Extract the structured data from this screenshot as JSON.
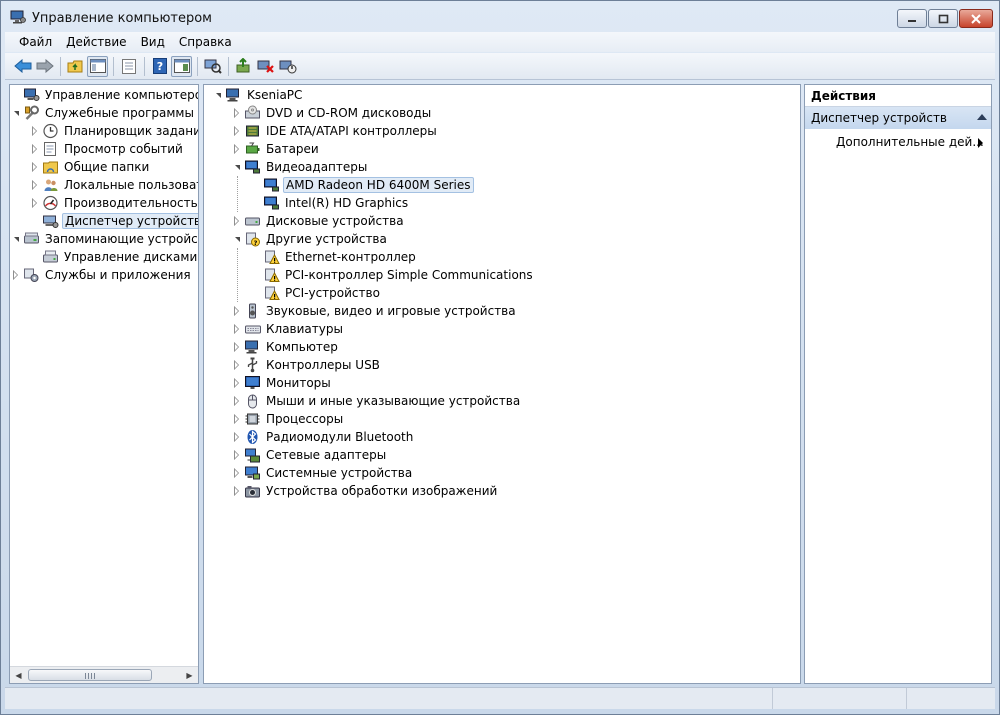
{
  "window": {
    "title": "Управление компьютером"
  },
  "menu": [
    "Файл",
    "Действие",
    "Вид",
    "Справка"
  ],
  "left_tree": [
    {
      "label": "Управление компьютером (л",
      "icon": "computer-management-icon",
      "expander": "none"
    },
    {
      "label": "Служебные программы",
      "icon": "tools-icon",
      "expander": "expanded"
    },
    {
      "label": "Планировщик заданий",
      "icon": "clock-icon",
      "expander": "collapsed"
    },
    {
      "label": "Просмотр событий",
      "icon": "event-viewer-icon",
      "expander": "collapsed"
    },
    {
      "label": "Общие папки",
      "icon": "shared-folder-icon",
      "expander": "collapsed"
    },
    {
      "label": "Локальные пользовате",
      "icon": "users-icon",
      "expander": "collapsed"
    },
    {
      "label": "Производительность",
      "icon": "performance-icon",
      "expander": "collapsed"
    },
    {
      "label": "Диспетчер устройств",
      "icon": "device-manager-icon",
      "expander": "none",
      "selected": true
    },
    {
      "label": "Запоминающие устройст",
      "icon": "storage-icon",
      "expander": "expanded"
    },
    {
      "label": "Управление дисками",
      "icon": "disk-management-icon",
      "expander": "none"
    },
    {
      "label": "Службы и приложения",
      "icon": "services-icon",
      "expander": "collapsed"
    }
  ],
  "device_tree": [
    {
      "label": "KseniaPC",
      "icon": "computer-icon",
      "expander": "expanded"
    },
    {
      "label": "DVD и CD-ROM дисководы",
      "icon": "dvd-drive-icon",
      "expander": "collapsed"
    },
    {
      "label": "IDE ATA/ATAPI контроллеры",
      "icon": "ide-controller-icon",
      "expander": "collapsed"
    },
    {
      "label": "Батареи",
      "icon": "battery-icon",
      "expander": "collapsed"
    },
    {
      "label": "Видеоадаптеры",
      "icon": "display-adapter-icon",
      "expander": "expanded"
    },
    {
      "label": "AMD Radeon HD 6400M Series",
      "icon": "display-adapter-icon",
      "expander": "none",
      "selected": true
    },
    {
      "label": "Intel(R) HD Graphics",
      "icon": "display-adapter-icon",
      "expander": "none"
    },
    {
      "label": "Дисковые устройства",
      "icon": "disk-drive-icon",
      "expander": "collapsed"
    },
    {
      "label": "Другие устройства",
      "icon": "unknown-device-icon",
      "expander": "expanded"
    },
    {
      "label": "Ethernet-контроллер",
      "icon": "warning-device-icon",
      "expander": "none"
    },
    {
      "label": "PCI-контроллер Simple Communications",
      "icon": "warning-device-icon",
      "expander": "none"
    },
    {
      "label": "PCI-устройство",
      "icon": "warning-device-icon",
      "expander": "none"
    },
    {
      "label": "Звуковые, видео и игровые устройства",
      "icon": "speaker-icon",
      "expander": "collapsed"
    },
    {
      "label": "Клавиатуры",
      "icon": "keyboard-icon",
      "expander": "collapsed"
    },
    {
      "label": "Компьютер",
      "icon": "computer-icon",
      "expander": "collapsed"
    },
    {
      "label": "Контроллеры USB",
      "icon": "usb-icon",
      "expander": "collapsed"
    },
    {
      "label": "Мониторы",
      "icon": "monitor-icon",
      "expander": "collapsed"
    },
    {
      "label": "Мыши и иные указывающие устройства",
      "icon": "mouse-icon",
      "expander": "collapsed"
    },
    {
      "label": "Процессоры",
      "icon": "processor-icon",
      "expander": "collapsed"
    },
    {
      "label": "Радиомодули Bluetooth",
      "icon": "bluetooth-icon",
      "expander": "collapsed"
    },
    {
      "label": "Сетевые адаптеры",
      "icon": "network-adapter-icon",
      "expander": "collapsed"
    },
    {
      "label": "Системные устройства",
      "icon": "system-device-icon",
      "expander": "collapsed"
    },
    {
      "label": "Устройства обработки изображений",
      "icon": "camera-icon",
      "expander": "collapsed"
    }
  ],
  "actions": {
    "header": "Действия",
    "section": "Диспетчер устройств",
    "more": "Дополнительные дей..."
  },
  "colors": {
    "selection_bg": "#e1ebf6",
    "selection_border": "#a4c1e2",
    "action_section": "#c4d7ee"
  }
}
